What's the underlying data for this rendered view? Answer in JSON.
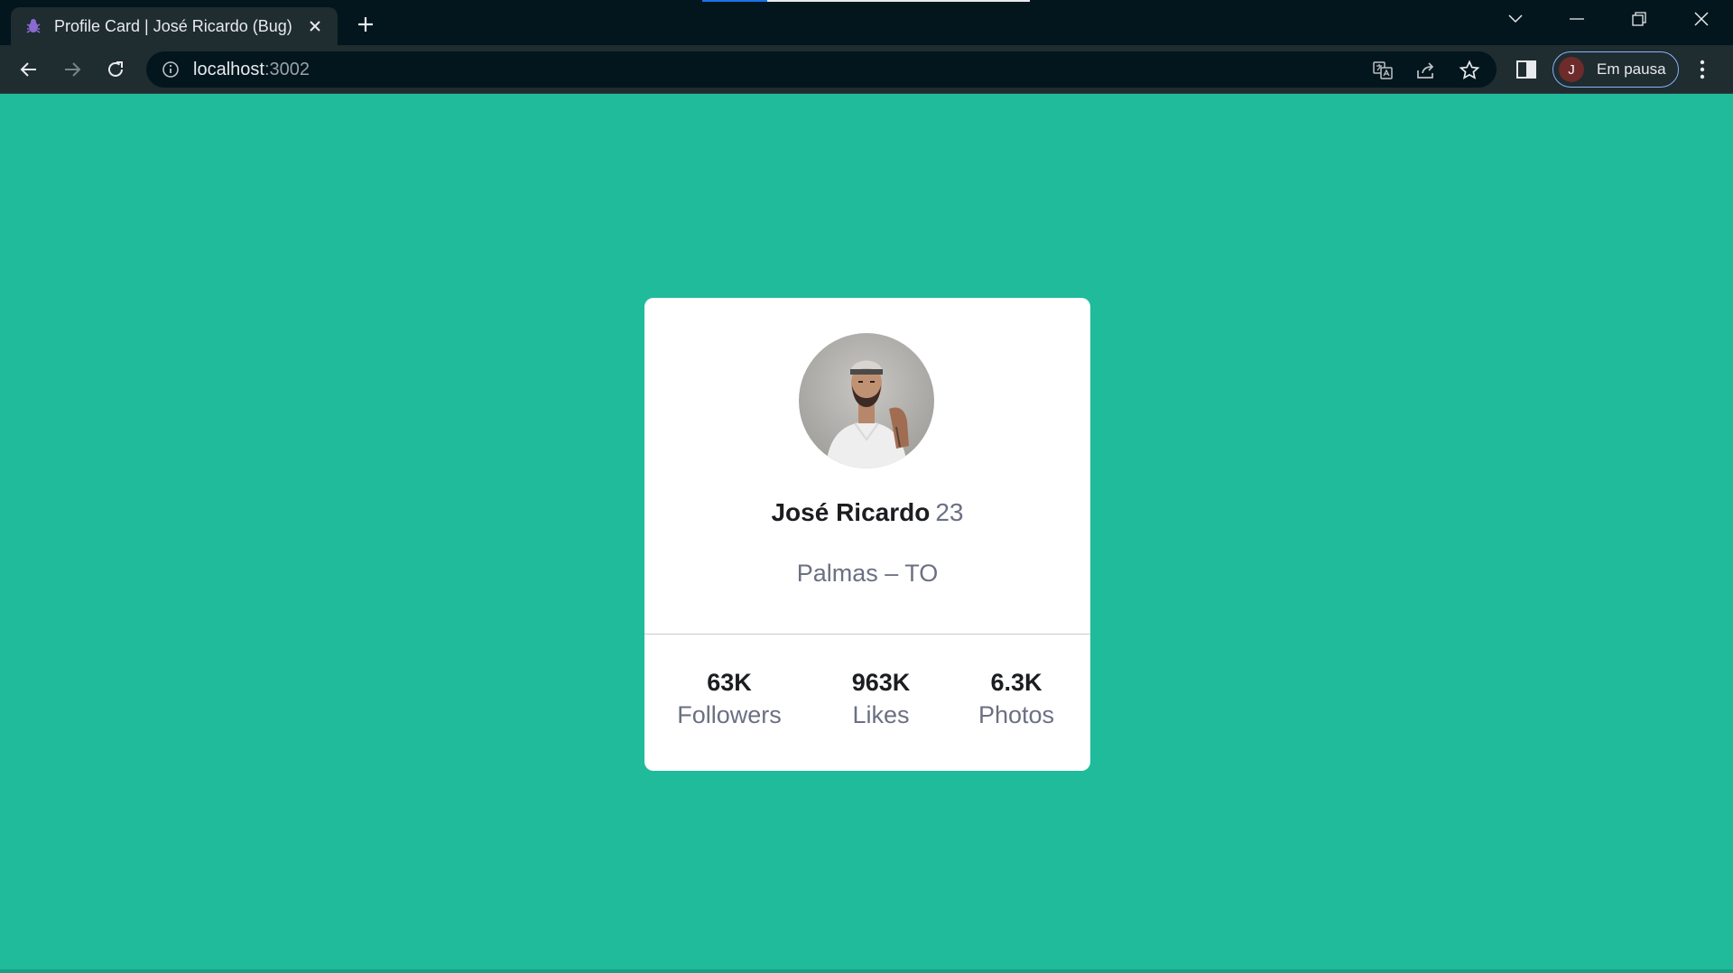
{
  "browser": {
    "tab_title": "Profile Card | José Ricardo (Bug)",
    "url_host": "localhost",
    "url_port": ":3002",
    "profile_initial": "J",
    "profile_status": "Em pausa",
    "icons": [
      "bug-icon",
      "close-icon",
      "plus-icon",
      "chevron-down-icon",
      "minimize-icon",
      "restore-icon",
      "window-close-icon",
      "back-arrow-icon",
      "forward-arrow-icon",
      "reload-icon",
      "info-icon",
      "translate-icon",
      "share-icon",
      "star-icon",
      "side-panel-icon",
      "kebab-menu-icon"
    ]
  },
  "profile": {
    "name": "José Ricardo",
    "age": "23",
    "location": "Palmas – TO",
    "stats": [
      {
        "value": "63K",
        "label": "Followers"
      },
      {
        "value": "963K",
        "label": "Likes"
      },
      {
        "value": "6.3K",
        "label": "Photos"
      }
    ]
  },
  "colors": {
    "page_background": "#20bb9a",
    "card_background": "#ffffff",
    "text_dark": "#1b1d20",
    "text_muted": "#6b7082"
  }
}
